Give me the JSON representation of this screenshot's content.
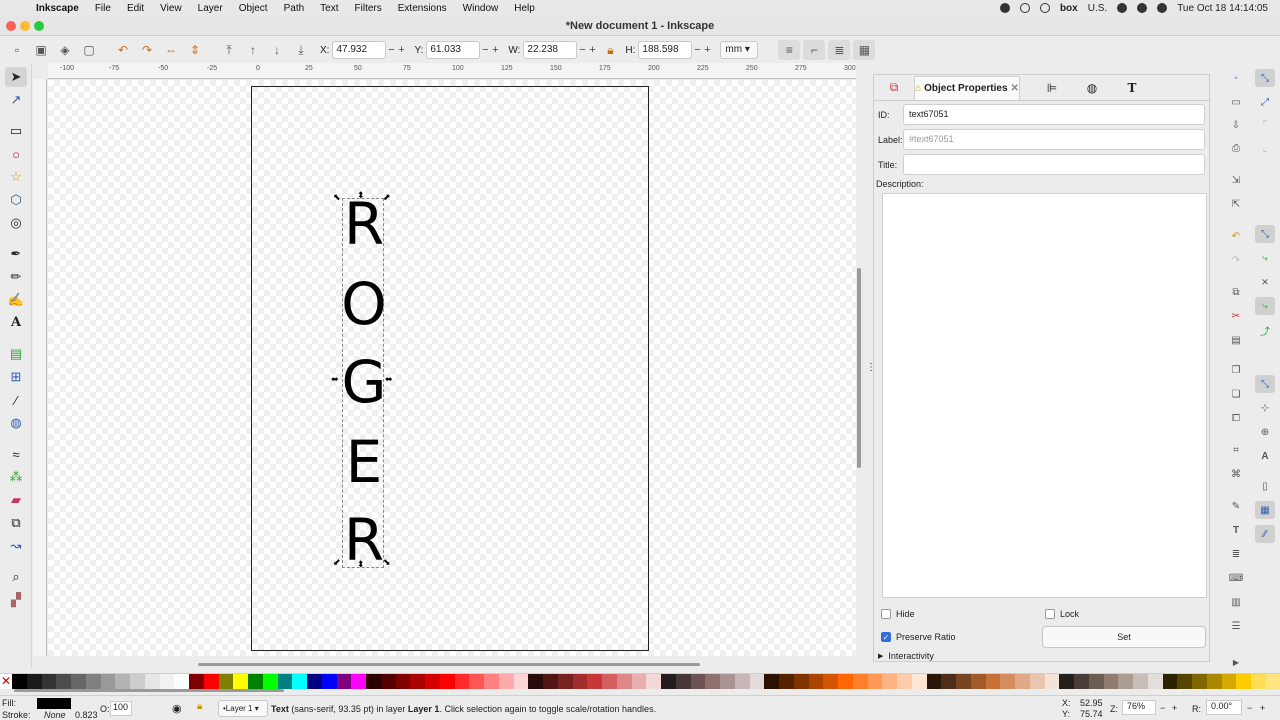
{
  "menubar": {
    "app": "Inkscape",
    "items": [
      "File",
      "Edit",
      "View",
      "Layer",
      "Object",
      "Path",
      "Text",
      "Filters",
      "Extensions",
      "Window",
      "Help"
    ],
    "locale": "U.S.",
    "datetime": "Tue Oct 18  14:14:05"
  },
  "window": {
    "title": "*New document 1 - Inkscape"
  },
  "toolbar": {
    "x_label": "X:",
    "x": "47.932",
    "y_label": "Y:",
    "y": "61.033",
    "w_label": "W:",
    "w": "22.238",
    "h_label": "H:",
    "h": "188.598",
    "unit": "mm"
  },
  "ruler": {
    "labels": [
      "-100",
      "-75",
      "-50",
      "-25",
      "0",
      "25",
      "50",
      "75",
      "100",
      "125",
      "150",
      "175",
      "200",
      "225",
      "250",
      "275",
      "300"
    ]
  },
  "canvas": {
    "letters": [
      "R",
      "O",
      "G",
      "E",
      "R"
    ]
  },
  "panel": {
    "tab_active": "Object Properties",
    "tab_icons": [
      "fill-stroke-icon",
      "align-icon",
      "symbols-icon",
      "text-font-icon"
    ],
    "id_label": "ID:",
    "id_value": "text67051",
    "label_label": "Label:",
    "label_placeholder": "#text67051",
    "title_label": "Title:",
    "title_value": "",
    "description_label": "Description:",
    "hide_label": "Hide",
    "lock_label": "Lock",
    "preserve_label": "Preserve Ratio",
    "set_label": "Set",
    "interactivity_label": "Interactivity"
  },
  "palette": {
    "colors": [
      "#000000",
      "#1a1a1a",
      "#333333",
      "#4d4d4d",
      "#666666",
      "#808080",
      "#999999",
      "#b3b3b3",
      "#cccccc",
      "#e6e6e6",
      "#f2f2f2",
      "#ffffff",
      "#800000",
      "#ff0000",
      "#808000",
      "#ffff00",
      "#008000",
      "#00ff00",
      "#008080",
      "#00ffff",
      "#000080",
      "#0000ff",
      "#800080",
      "#ff00ff",
      "#2b0000",
      "#550000",
      "#800000",
      "#aa0000",
      "#d40000",
      "#ff0000",
      "#ff2a2a",
      "#ff5555",
      "#ff8080",
      "#ffaaaa",
      "#ffd5d5",
      "#280b0b",
      "#501616",
      "#782121",
      "#a02c2c",
      "#c83737",
      "#d35f5f",
      "#de8787",
      "#e9afaf",
      "#f4d7d7",
      "#241c1c",
      "#483737",
      "#6c5353",
      "#916f6f",
      "#ac9393",
      "#c8b7b7",
      "#e3dbdb",
      "#2b1100",
      "#552200",
      "#803300",
      "#aa4400",
      "#d45500",
      "#ff6600",
      "#ff7f2a",
      "#ff9955",
      "#ffb380",
      "#ffccaa",
      "#ffe6d5",
      "#28170b",
      "#502d16",
      "#784421",
      "#a05a2c",
      "#c87137",
      "#d38d5f",
      "#deaa87",
      "#e9c6af",
      "#f4e3d7",
      "#241f1c",
      "#483e37",
      "#6c5d53",
      "#917c6f",
      "#ac9d93",
      "#c8beb7",
      "#e3dedb",
      "#2b2200",
      "#554400",
      "#806600",
      "#aa8800",
      "#d4aa00",
      "#ffcc00",
      "#ffdd55",
      "#ffe680"
    ]
  },
  "status": {
    "fill_label": "Fill:",
    "stroke_label": "Stroke:",
    "stroke_value": "None",
    "stroke_width": "0.823",
    "opacity_label": "O:",
    "opacity_value": "100",
    "layer": "•Layer 1",
    "msg_bold": "Text",
    "msg_rest": " (sans-serif, 93.35 pt) in layer ",
    "msg_layer": "Layer 1",
    "msg_end": ". Click selection again to toggle scale/rotation handles.",
    "cx_label": "X:",
    "cx": "52.95",
    "cy_label": "Y:",
    "cy": "75.74",
    "zoom_label": "Z:",
    "zoom": "76%",
    "rot_label": "R:",
    "rotation": "0.00°"
  }
}
